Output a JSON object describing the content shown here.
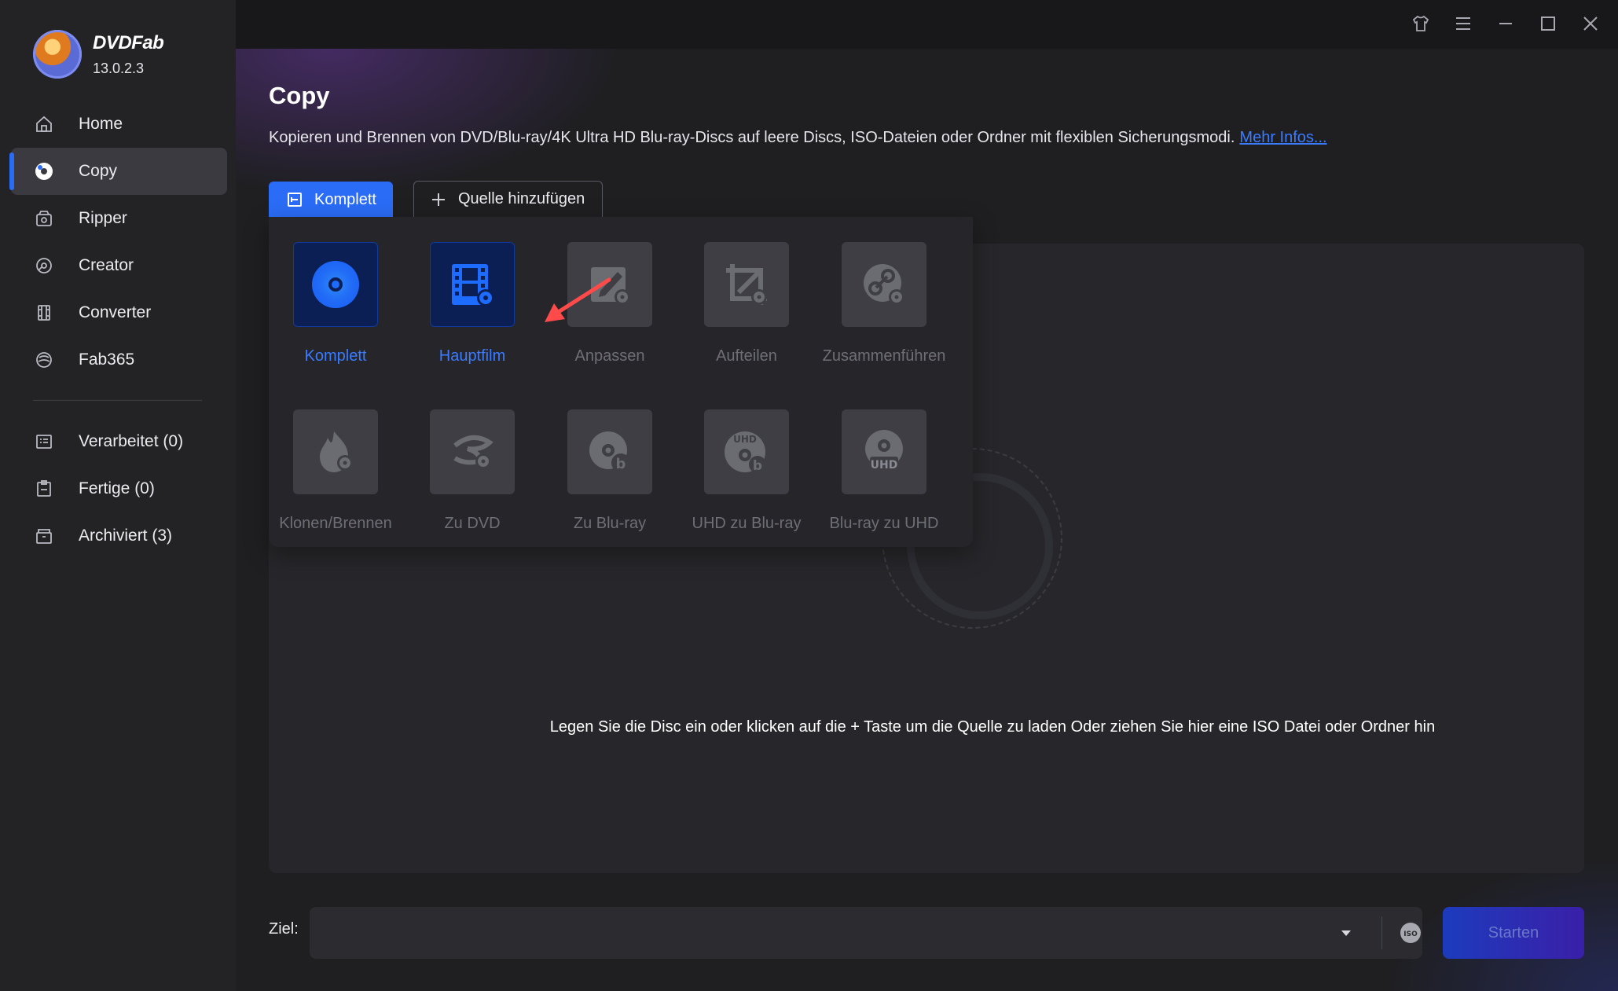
{
  "app": {
    "name": "DVDFab",
    "version": "13.0.2.3"
  },
  "sidebar": {
    "items": [
      {
        "label": "Home",
        "icon": "home-icon"
      },
      {
        "label": "Copy",
        "icon": "copy-disc-icon",
        "active": true
      },
      {
        "label": "Ripper",
        "icon": "ripper-icon"
      },
      {
        "label": "Creator",
        "icon": "creator-icon"
      },
      {
        "label": "Converter",
        "icon": "converter-icon"
      },
      {
        "label": "Fab365",
        "icon": "fab365-icon"
      }
    ],
    "task_items": [
      {
        "label": "Verarbeitet (0)",
        "icon": "queue-icon"
      },
      {
        "label": "Fertige (0)",
        "icon": "clipboard-icon"
      },
      {
        "label": "Archiviert (3)",
        "icon": "archive-icon"
      }
    ]
  },
  "titlebar": {
    "icons": [
      "shirt-icon",
      "menu-icon",
      "minimize-icon",
      "maximize-icon",
      "close-icon"
    ]
  },
  "page": {
    "title": "Copy",
    "description": "Kopieren und Brennen von DVD/Blu-ray/4K Ultra HD Blu-ray-Discs auf leere Discs, ISO-Dateien oder Ordner mit flexiblen Sicherungsmodi.",
    "more_link": "Mehr Infos..."
  },
  "toolbar": {
    "mode_label": "Komplett",
    "add_source_label": "Quelle hinzufügen"
  },
  "modes": [
    {
      "label": "Komplett",
      "icon": "full-disc-icon",
      "active": true
    },
    {
      "label": "Hauptfilm",
      "icon": "main-movie-icon",
      "active": true
    },
    {
      "label": "Anpassen",
      "icon": "customize-icon"
    },
    {
      "label": "Aufteilen",
      "icon": "split-icon"
    },
    {
      "label": "Zusammenführen",
      "icon": "merge-icon"
    },
    {
      "label": "Klonen/Brennen",
      "icon": "clone-burn-icon"
    },
    {
      "label": "Zu DVD",
      "icon": "to-dvd-icon"
    },
    {
      "label": "Zu Blu-ray",
      "icon": "to-bluray-icon"
    },
    {
      "label": "UHD zu Blu-ray",
      "icon": "uhd-to-bluray-icon"
    },
    {
      "label": "Blu-ray zu UHD",
      "icon": "bluray-to-uhd-icon"
    }
  ],
  "drop_area": {
    "hint": "Legen Sie die Disc ein oder klicken auf die + Taste um die Quelle zu laden Oder ziehen Sie hier eine ISO Datei oder Ordner hin"
  },
  "bottom": {
    "dest_label": "Ziel:",
    "dest_value": "",
    "start_label": "Starten"
  },
  "colors": {
    "accent": "#2a6cf6",
    "link": "#3a7bff",
    "sidebar_bg": "#232326",
    "main_bg": "#1f1f22",
    "arrow": "#ff4a4a"
  }
}
